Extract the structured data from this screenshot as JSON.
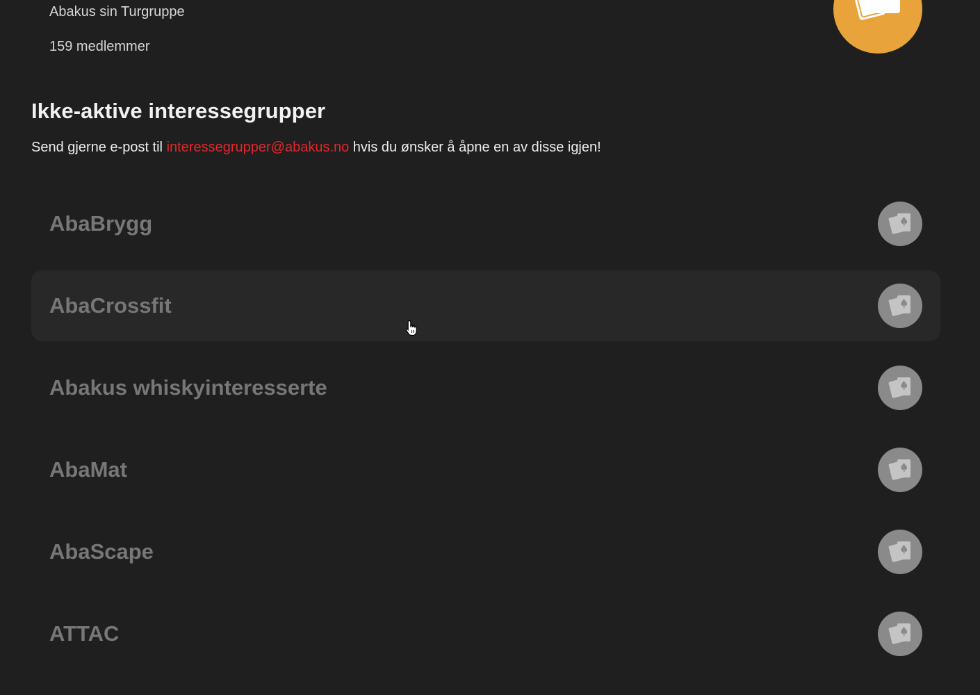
{
  "active_group": {
    "description": "Abakus sin Turgruppe",
    "members": "159 medlemmer",
    "logo_icon": "playing-cards-icon",
    "logo_color": "#e9a33b"
  },
  "inactive_section": {
    "title": "Ikke-aktive interessegrupper",
    "text_before": "Send gjerne e-post til ",
    "email": "interessegrupper@abakus.no",
    "text_after": " hvis du ønsker å åpne en av disse igjen!",
    "accent_color": "#e3262b"
  },
  "inactive_groups": [
    {
      "name": "AbaBrygg"
    },
    {
      "name": "AbaCrossfit"
    },
    {
      "name": "Abakus whiskyinteresserte"
    },
    {
      "name": "AbaMat"
    },
    {
      "name": "AbaScape"
    },
    {
      "name": "ATTAC"
    }
  ],
  "inactive_logo_icon": "playing-cards-icon",
  "inactive_logo_color": "#8a8a8a"
}
